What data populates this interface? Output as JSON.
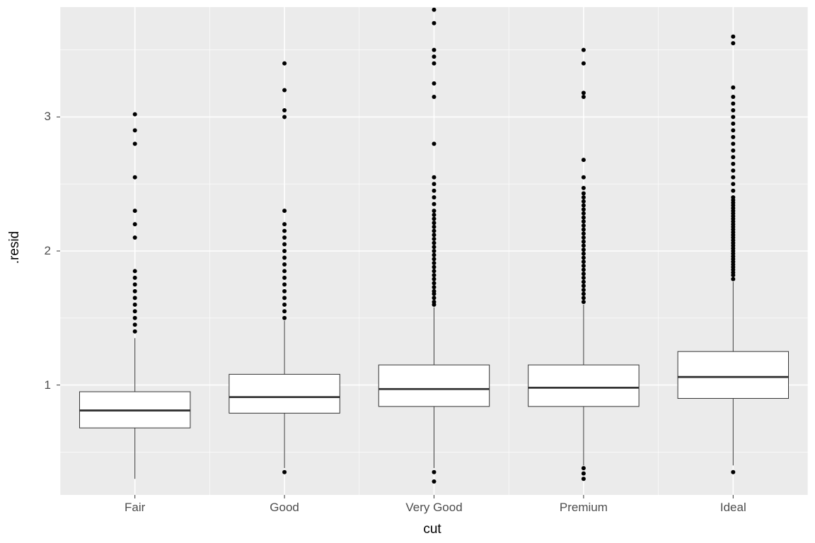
{
  "chart_data": {
    "type": "boxplot",
    "title": "",
    "xlabel": "cut",
    "ylabel": ".resid",
    "categories": [
      "Fair",
      "Good",
      "Very Good",
      "Premium",
      "Ideal"
    ],
    "y_ticks": [
      1,
      2,
      3
    ],
    "ylim": [
      0.18,
      3.82
    ],
    "boxes": [
      {
        "category": "Fair",
        "lower_whisker": 0.3,
        "q1": 0.68,
        "median": 0.81,
        "q3": 0.95,
        "upper_whisker": 1.35
      },
      {
        "category": "Good",
        "lower_whisker": 0.38,
        "q1": 0.79,
        "median": 0.91,
        "q3": 1.08,
        "upper_whisker": 1.48
      },
      {
        "category": "Very Good",
        "lower_whisker": 0.38,
        "q1": 0.84,
        "median": 0.97,
        "q3": 1.15,
        "upper_whisker": 1.58
      },
      {
        "category": "Premium",
        "lower_whisker": 0.4,
        "q1": 0.84,
        "median": 0.98,
        "q3": 1.15,
        "upper_whisker": 1.6
      },
      {
        "category": "Ideal",
        "lower_whisker": 0.4,
        "q1": 0.9,
        "median": 1.06,
        "q3": 1.25,
        "upper_whisker": 1.77
      }
    ],
    "outliers": {
      "Fair": [
        1.4,
        1.45,
        1.5,
        1.55,
        1.6,
        1.65,
        1.7,
        1.75,
        1.8,
        1.85,
        2.1,
        2.2,
        2.3,
        2.55,
        2.8,
        2.9,
        3.02
      ],
      "Good": [
        0.35,
        1.5,
        1.55,
        1.6,
        1.65,
        1.7,
        1.75,
        1.8,
        1.85,
        1.9,
        1.95,
        2.0,
        2.05,
        2.1,
        2.15,
        2.2,
        2.3,
        3.0,
        3.05,
        3.2,
        3.4
      ],
      "Very Good": [
        0.28,
        0.35,
        1.6,
        1.62,
        1.65,
        1.68,
        1.7,
        1.73,
        1.76,
        1.79,
        1.82,
        1.85,
        1.88,
        1.91,
        1.94,
        1.97,
        2.0,
        2.03,
        2.06,
        2.09,
        2.12,
        2.15,
        2.18,
        2.21,
        2.24,
        2.27,
        2.3,
        2.35,
        2.4,
        2.45,
        2.5,
        2.55,
        2.8,
        3.15,
        3.25,
        3.4,
        3.45,
        3.5,
        3.7,
        3.8
      ],
      "Premium": [
        0.3,
        0.34,
        0.38,
        1.62,
        1.65,
        1.68,
        1.71,
        1.74,
        1.77,
        1.8,
        1.83,
        1.86,
        1.89,
        1.92,
        1.95,
        1.98,
        2.01,
        2.04,
        2.07,
        2.1,
        2.13,
        2.16,
        2.19,
        2.22,
        2.25,
        2.28,
        2.31,
        2.34,
        2.37,
        2.4,
        2.43,
        2.47,
        2.55,
        2.68,
        3.15,
        3.18,
        3.4,
        3.5
      ],
      "Ideal": [
        0.35,
        1.79,
        1.82,
        1.84,
        1.86,
        1.88,
        1.9,
        1.92,
        1.94,
        1.96,
        1.98,
        2.0,
        2.02,
        2.04,
        2.06,
        2.08,
        2.1,
        2.12,
        2.14,
        2.16,
        2.18,
        2.2,
        2.22,
        2.24,
        2.26,
        2.28,
        2.3,
        2.32,
        2.34,
        2.36,
        2.38,
        2.4,
        2.45,
        2.5,
        2.55,
        2.6,
        2.65,
        2.7,
        2.75,
        2.8,
        2.85,
        2.9,
        2.95,
        3.0,
        3.05,
        3.1,
        3.15,
        3.22,
        3.55,
        3.6
      ]
    }
  }
}
